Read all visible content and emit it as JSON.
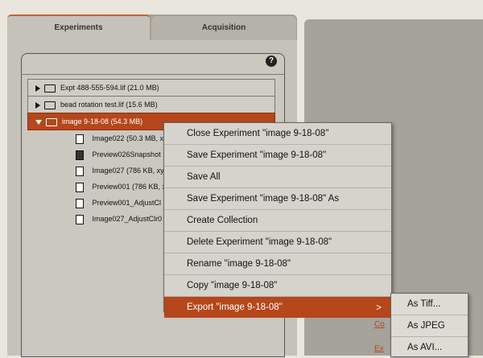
{
  "tabs": [
    {
      "label": "Experiments",
      "active": true
    },
    {
      "label": "Acquisition",
      "active": false
    }
  ],
  "help_label": "?",
  "tree": {
    "experiments": [
      {
        "label": "Expt 488-555-594.lif (21.0 MB)",
        "expanded": false,
        "selected": false
      },
      {
        "label": "bead rotation test.lif (15.6 MB)",
        "expanded": false,
        "selected": false
      },
      {
        "label": "image 9-18-08 (54.3 MB)",
        "expanded": true,
        "selected": true
      }
    ],
    "children": [
      {
        "label": "Image022 (50.3 MB, x",
        "icon": "document-icon"
      },
      {
        "label": "Preview026Snapshot",
        "icon": "document-filled-icon"
      },
      {
        "label": "Image027 (786 KB, xy",
        "icon": "document-icon"
      },
      {
        "label": "Preview001 (786 KB, x",
        "icon": "document-icon"
      },
      {
        "label": "Preview001_AdjustCl",
        "icon": "document-icon"
      },
      {
        "label": "Image027_AdjustClr0",
        "icon": "document-icon"
      }
    ]
  },
  "context_menu": {
    "items": [
      {
        "label": "Close Experiment \"image 9-18-08\""
      },
      {
        "label": "Save Experiment \"image 9-18-08\""
      },
      {
        "label": "Save All"
      },
      {
        "label": "Save Experiment \"image 9-18-08\" As"
      },
      {
        "label": "Create Collection"
      },
      {
        "label": "Delete Experiment \"image 9-18-08\""
      },
      {
        "label": "Rename \"image 9-18-08\""
      },
      {
        "label": "Copy \"image 9-18-08\""
      },
      {
        "label": "Export \"image 9-18-08\"",
        "highlighted": true,
        "submenu_arrow": ">"
      }
    ]
  },
  "export_submenu": {
    "items": [
      {
        "label": "As Tiff..."
      },
      {
        "label": "As JPEG"
      },
      {
        "label": "As AVI..."
      }
    ]
  },
  "colors": {
    "accent": "#b5471a",
    "background": "#e9e6dd",
    "menu_bg": "#d6d3cc"
  }
}
